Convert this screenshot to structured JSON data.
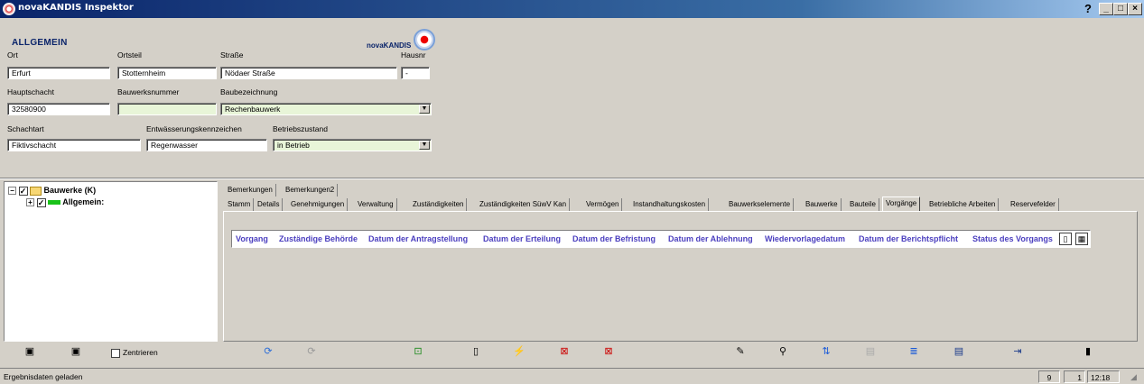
{
  "window": {
    "title": "novaKANDIS Inspektor",
    "controls": [
      "_",
      "□",
      "×"
    ],
    "help": "?"
  },
  "top": {
    "section_title": "ALLGEMEIN",
    "logo": "novaKANDIS",
    "fields": {
      "ort": {
        "label": "Ort",
        "value": "Erfurt"
      },
      "ortsteil": {
        "label": "Ortsteil",
        "value": "Stotternheim"
      },
      "strasse": {
        "label": "Straße",
        "value": "Nödaer Straße"
      },
      "hausnr": {
        "label": "Hausnr",
        "value": "-"
      },
      "hauptschacht": {
        "label": "Hauptschacht",
        "value": "32580900"
      },
      "bauwerksnummer": {
        "label": "Bauwerksnummer",
        "value": ""
      },
      "baubezeichnung": {
        "label": "Baubezeichnung",
        "value": "Rechenbauwerk"
      },
      "schachtart": {
        "label": "Schachtart",
        "value": "Fiktivschacht"
      },
      "entwaesserung": {
        "label": "Entwässerungskennzeichen",
        "value": "Regenwasser"
      },
      "betriebszustand": {
        "label": "Betriebszustand",
        "value": "in Betrieb"
      }
    }
  },
  "tree": {
    "root": {
      "label": "Bauwerke (K)"
    },
    "child": {
      "label": "Allgemein:"
    }
  },
  "tabs_row1": [
    "Bemerkungen",
    "Bemerkungen2"
  ],
  "tabs_row2": [
    "Stamm",
    "Details",
    "Genehmigungen",
    "Verwaltung",
    "Zuständigkeiten",
    "Zuständigkeiten SüwV Kan",
    "Vermögen",
    "Instandhaltungskosten",
    "Bauwerkselemente",
    "Bauwerke",
    "Bauteile",
    "Vorgänge",
    "Betriebliche Arbeiten",
    "Reservefelder"
  ],
  "active_tab": "Vorgänge",
  "columns": [
    "Vorgang",
    "Zuständige Behörde",
    "Datum der Antragstellung",
    "Datum der Erteilung",
    "Datum der Befristung",
    "Datum der Ablehnung",
    "Wiedervorlagedatum",
    "Datum der Berichtspflicht",
    "Status des Vorgangs"
  ],
  "toolbar": {
    "zentrieren": "Zentrieren",
    "icons": [
      "map-icon",
      "map2-icon",
      "refresh-icon",
      "refresh-disabled-icon",
      "import-icon",
      "new-document-icon",
      "wand-icon",
      "export-icon",
      "delete-icon",
      "edit-icon",
      "search-icon",
      "sort-icon",
      "disabled-icon",
      "list-edit-icon",
      "save-icon",
      "exit-icon",
      "close-icon"
    ]
  },
  "statusbar": {
    "message": "Ergebnisdaten geladen",
    "count1": "9",
    "count2": "1",
    "time": "12:18"
  },
  "colors": {
    "title_gradient_start": "#0a246a",
    "column_header_text": "#4b3fbf",
    "input_highlight": "#e8f5d8"
  }
}
